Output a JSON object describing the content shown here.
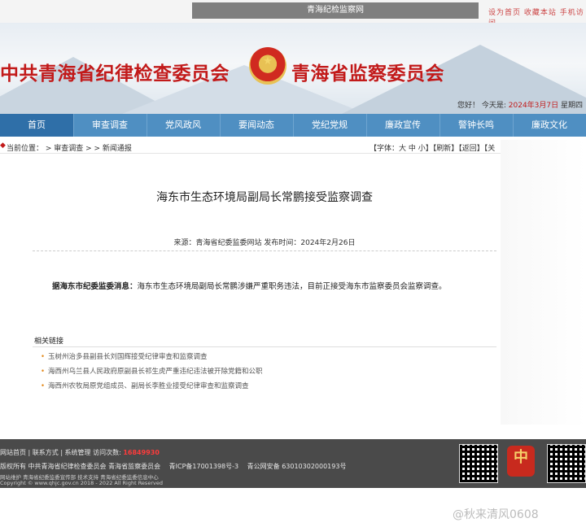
{
  "topbar": {
    "title": "青海纪检监察网",
    "links": "设为首页  收藏本站  手机访问"
  },
  "header": {
    "left_title": "中共青海省纪律检查委员会",
    "right_title": "青海省监察委员会",
    "greeting_prefix": "您好！ 今天是:",
    "date": "2024年3月7日",
    "weekday": "星期四"
  },
  "nav": [
    "首页",
    "审查调查",
    "党风政风",
    "要闻动态",
    "党纪党规",
    "廉政宣传",
    "警钟长鸣",
    "廉政文化"
  ],
  "breadcrumb": {
    "text": "当前位置： > 审查调查 > > 新闻通报",
    "tools": "【字体：大 中 小】【刷新】【返回】【关"
  },
  "article": {
    "title": "海东市生态环境局副局长常鹏接受监察调查",
    "meta": "来源：青海省纪委监委网站    发布时间：2024年2月26日",
    "lead": "据海东市纪委监委消息：",
    "body": "海东市生态环境局副局长常鹏涉嫌严重职务违法，目前正接受海东市监察委员会监察调查。"
  },
  "related": {
    "heading": "相关链接",
    "items": [
      "玉树州治多县副县长刘国辉接受纪律审查和监察调查",
      "海西州乌兰县人民政府原副县长祁生虎严重违纪违法被开除党籍和公职",
      "海西州农牧局原党组成员、副局长李胜业接受纪律审查和监察调查"
    ]
  },
  "footer": {
    "links": "网站首页 | 联系方式 | 系统管理  访问次数:",
    "visits": "16849930",
    "copyright": "版权所有  中共青海省纪律检查委员会 青海省监察委员会",
    "icp": "青ICP备17001398号-3",
    "police": "青公网安备 63010302000193号",
    "line3": "网站维护  青海省纪委监委宣传部   技术支持  青海省纪委监委信息中心",
    "line4": "Copyright © www.qhjc.gov.cn 2018 - 2022 All Right Reserved"
  },
  "watermark": "@秋来清风0608",
  "colors": {
    "nav": "#4f8fc2",
    "brand_red": "#c21a1a",
    "footer": "#4a4a4a"
  }
}
